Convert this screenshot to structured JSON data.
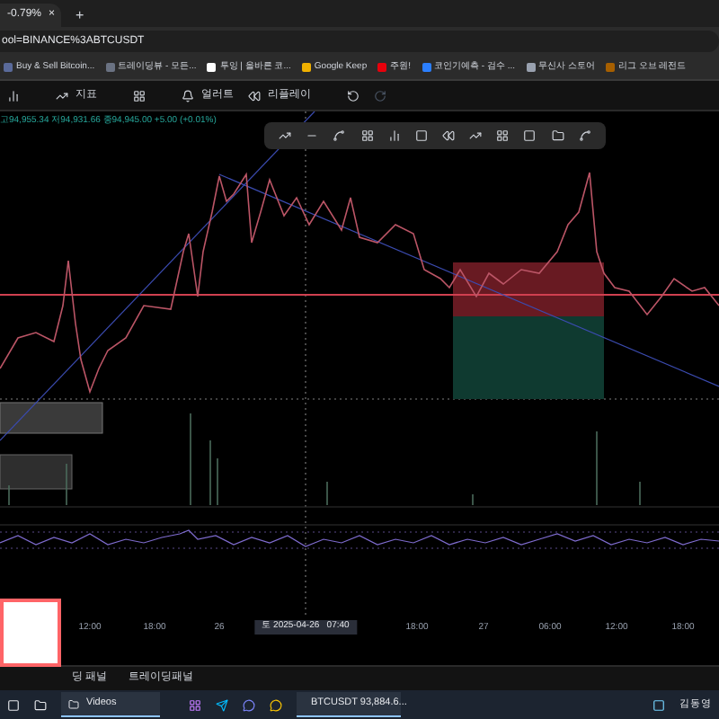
{
  "browser": {
    "tab": {
      "title": "-0.79%",
      "close": "×"
    },
    "new_tab": "+",
    "address": "ool=BINANCE%3ABTCUSDT",
    "bookmarks": [
      {
        "label": "Buy & Sell Bitcoin..."
      },
      {
        "label": "트레이딩뷰 - 모든..."
      },
      {
        "label": "투잉 | 올바른 코..."
      },
      {
        "label": "Google Keep"
      },
      {
        "label": "주원!"
      },
      {
        "label": "코인기예측 - 검수 ..."
      },
      {
        "label": "무신사 스토어"
      },
      {
        "label": "리그 오브 레전드"
      }
    ]
  },
  "toolbar": {
    "indicators": "지표",
    "alert": "얼러트",
    "replay": "리플레이"
  },
  "chart": {
    "ohlc": "고94,955.34 저94,931.66 종94,945.00 +5.00 (+0.01%)"
  },
  "time_axis": [
    {
      "label": "12:00",
      "kind": "tick"
    },
    {
      "label": "18:00",
      "kind": "tick"
    },
    {
      "label": "26",
      "kind": "tick"
    },
    {
      "label": "토 2025-04-26   07:40",
      "kind": "cursor"
    },
    {
      "label": "18:00",
      "kind": "tick"
    },
    {
      "label": "27",
      "kind": "tick"
    },
    {
      "label": "06:00",
      "kind": "tick"
    },
    {
      "label": "12:00",
      "kind": "tick"
    },
    {
      "label": "18:00",
      "kind": "tick"
    }
  ],
  "bottom_panel": {
    "tabs": [
      "딩 패널",
      "트레이딩패널"
    ]
  },
  "taskbar": {
    "videos": "Videos",
    "browser_window": "BTCUSDT 93,884.6...",
    "user": "김동영"
  }
}
